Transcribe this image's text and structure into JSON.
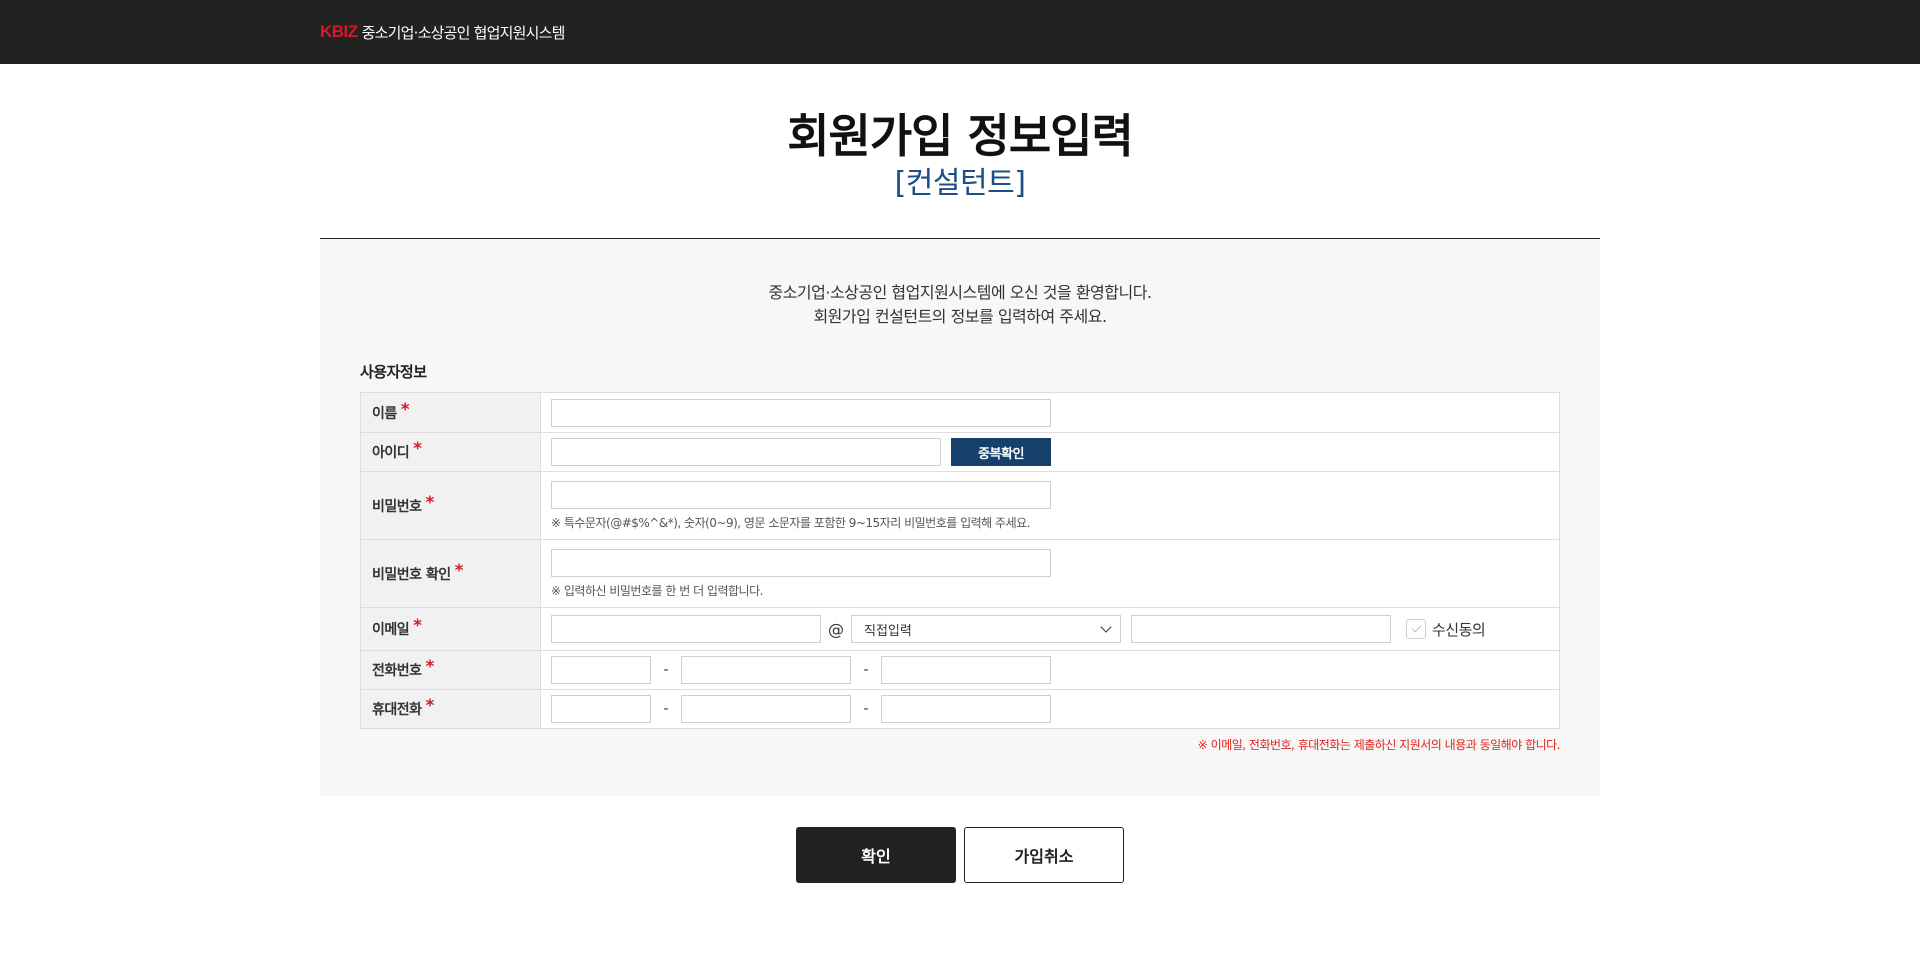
{
  "header": {
    "logo_mark": "KBIZ",
    "logo_text": "중소기업·소상공인 협업지원시스템"
  },
  "title": {
    "main": "회원가입 정보입력",
    "sub": "[컨설턴트]"
  },
  "welcome": {
    "line1": "중소기업·소상공인 협업지원시스템에 오신 것을 환영합니다.",
    "line2": "회원가입 컨설턴트의 정보를 입력하여 주세요."
  },
  "section": {
    "title": "사용자정보"
  },
  "required_mark": "*",
  "form": {
    "name": {
      "label": "이름",
      "value": ""
    },
    "userid": {
      "label": "아이디",
      "value": "",
      "check_button": "중복확인"
    },
    "password": {
      "label": "비밀번호",
      "value": "",
      "hint": "※ 특수문자(@#$%^&*), 숫자(0~9), 영문 소문자를 포함한 9~15자리 비밀번호를 입력해 주세요."
    },
    "password_confirm": {
      "label": "비밀번호 확인",
      "value": "",
      "hint": "※ 입력하신 비밀번호를 한 번 더 입력합니다."
    },
    "email": {
      "label": "이메일",
      "local_value": "",
      "at": "@",
      "domain_select": "직접입력",
      "domain_value": "",
      "agree_label": "수신동의"
    },
    "phone": {
      "label": "전화번호",
      "sep": "-",
      "part1": "",
      "part2": "",
      "part3": ""
    },
    "mobile": {
      "label": "휴대전화",
      "sep": "-",
      "part1": "",
      "part2": "",
      "part3": ""
    }
  },
  "notice": "※ 이메일, 전화번호, 휴대전화는 제출하신 지원서의 내용과 동일해야 합니다.",
  "actions": {
    "confirm": "확인",
    "cancel": "가입취소"
  }
}
